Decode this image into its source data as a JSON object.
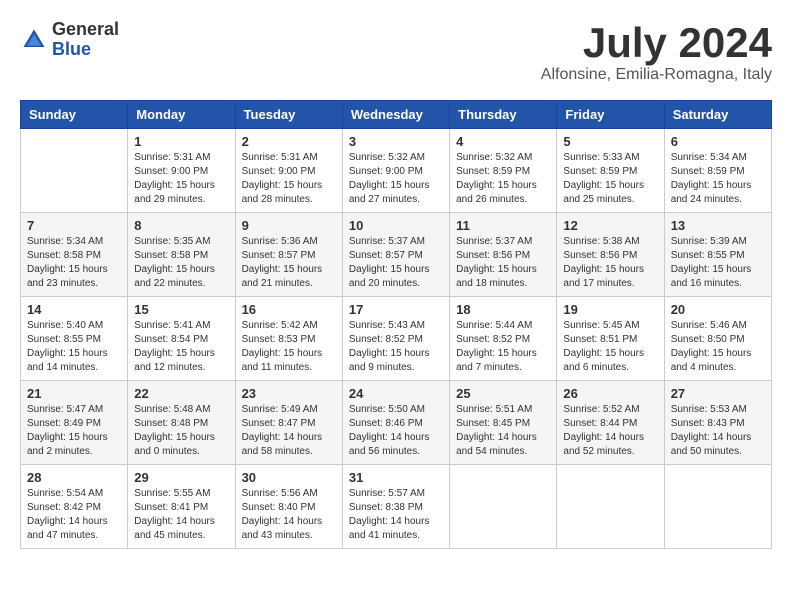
{
  "logo": {
    "general": "General",
    "blue": "Blue"
  },
  "title": {
    "month_year": "July 2024",
    "location": "Alfonsine, Emilia-Romagna, Italy"
  },
  "headers": [
    "Sunday",
    "Monday",
    "Tuesday",
    "Wednesday",
    "Thursday",
    "Friday",
    "Saturday"
  ],
  "weeks": [
    [
      {
        "day": "",
        "sunrise": "",
        "sunset": "",
        "daylight": ""
      },
      {
        "day": "1",
        "sunrise": "Sunrise: 5:31 AM",
        "sunset": "Sunset: 9:00 PM",
        "daylight": "Daylight: 15 hours and 29 minutes."
      },
      {
        "day": "2",
        "sunrise": "Sunrise: 5:31 AM",
        "sunset": "Sunset: 9:00 PM",
        "daylight": "Daylight: 15 hours and 28 minutes."
      },
      {
        "day": "3",
        "sunrise": "Sunrise: 5:32 AM",
        "sunset": "Sunset: 9:00 PM",
        "daylight": "Daylight: 15 hours and 27 minutes."
      },
      {
        "day": "4",
        "sunrise": "Sunrise: 5:32 AM",
        "sunset": "Sunset: 8:59 PM",
        "daylight": "Daylight: 15 hours and 26 minutes."
      },
      {
        "day": "5",
        "sunrise": "Sunrise: 5:33 AM",
        "sunset": "Sunset: 8:59 PM",
        "daylight": "Daylight: 15 hours and 25 minutes."
      },
      {
        "day": "6",
        "sunrise": "Sunrise: 5:34 AM",
        "sunset": "Sunset: 8:59 PM",
        "daylight": "Daylight: 15 hours and 24 minutes."
      }
    ],
    [
      {
        "day": "7",
        "sunrise": "Sunrise: 5:34 AM",
        "sunset": "Sunset: 8:58 PM",
        "daylight": "Daylight: 15 hours and 23 minutes."
      },
      {
        "day": "8",
        "sunrise": "Sunrise: 5:35 AM",
        "sunset": "Sunset: 8:58 PM",
        "daylight": "Daylight: 15 hours and 22 minutes."
      },
      {
        "day": "9",
        "sunrise": "Sunrise: 5:36 AM",
        "sunset": "Sunset: 8:57 PM",
        "daylight": "Daylight: 15 hours and 21 minutes."
      },
      {
        "day": "10",
        "sunrise": "Sunrise: 5:37 AM",
        "sunset": "Sunset: 8:57 PM",
        "daylight": "Daylight: 15 hours and 20 minutes."
      },
      {
        "day": "11",
        "sunrise": "Sunrise: 5:37 AM",
        "sunset": "Sunset: 8:56 PM",
        "daylight": "Daylight: 15 hours and 18 minutes."
      },
      {
        "day": "12",
        "sunrise": "Sunrise: 5:38 AM",
        "sunset": "Sunset: 8:56 PM",
        "daylight": "Daylight: 15 hours and 17 minutes."
      },
      {
        "day": "13",
        "sunrise": "Sunrise: 5:39 AM",
        "sunset": "Sunset: 8:55 PM",
        "daylight": "Daylight: 15 hours and 16 minutes."
      }
    ],
    [
      {
        "day": "14",
        "sunrise": "Sunrise: 5:40 AM",
        "sunset": "Sunset: 8:55 PM",
        "daylight": "Daylight: 15 hours and 14 minutes."
      },
      {
        "day": "15",
        "sunrise": "Sunrise: 5:41 AM",
        "sunset": "Sunset: 8:54 PM",
        "daylight": "Daylight: 15 hours and 12 minutes."
      },
      {
        "day": "16",
        "sunrise": "Sunrise: 5:42 AM",
        "sunset": "Sunset: 8:53 PM",
        "daylight": "Daylight: 15 hours and 11 minutes."
      },
      {
        "day": "17",
        "sunrise": "Sunrise: 5:43 AM",
        "sunset": "Sunset: 8:52 PM",
        "daylight": "Daylight: 15 hours and 9 minutes."
      },
      {
        "day": "18",
        "sunrise": "Sunrise: 5:44 AM",
        "sunset": "Sunset: 8:52 PM",
        "daylight": "Daylight: 15 hours and 7 minutes."
      },
      {
        "day": "19",
        "sunrise": "Sunrise: 5:45 AM",
        "sunset": "Sunset: 8:51 PM",
        "daylight": "Daylight: 15 hours and 6 minutes."
      },
      {
        "day": "20",
        "sunrise": "Sunrise: 5:46 AM",
        "sunset": "Sunset: 8:50 PM",
        "daylight": "Daylight: 15 hours and 4 minutes."
      }
    ],
    [
      {
        "day": "21",
        "sunrise": "Sunrise: 5:47 AM",
        "sunset": "Sunset: 8:49 PM",
        "daylight": "Daylight: 15 hours and 2 minutes."
      },
      {
        "day": "22",
        "sunrise": "Sunrise: 5:48 AM",
        "sunset": "Sunset: 8:48 PM",
        "daylight": "Daylight: 15 hours and 0 minutes."
      },
      {
        "day": "23",
        "sunrise": "Sunrise: 5:49 AM",
        "sunset": "Sunset: 8:47 PM",
        "daylight": "Daylight: 14 hours and 58 minutes."
      },
      {
        "day": "24",
        "sunrise": "Sunrise: 5:50 AM",
        "sunset": "Sunset: 8:46 PM",
        "daylight": "Daylight: 14 hours and 56 minutes."
      },
      {
        "day": "25",
        "sunrise": "Sunrise: 5:51 AM",
        "sunset": "Sunset: 8:45 PM",
        "daylight": "Daylight: 14 hours and 54 minutes."
      },
      {
        "day": "26",
        "sunrise": "Sunrise: 5:52 AM",
        "sunset": "Sunset: 8:44 PM",
        "daylight": "Daylight: 14 hours and 52 minutes."
      },
      {
        "day": "27",
        "sunrise": "Sunrise: 5:53 AM",
        "sunset": "Sunset: 8:43 PM",
        "daylight": "Daylight: 14 hours and 50 minutes."
      }
    ],
    [
      {
        "day": "28",
        "sunrise": "Sunrise: 5:54 AM",
        "sunset": "Sunset: 8:42 PM",
        "daylight": "Daylight: 14 hours and 47 minutes."
      },
      {
        "day": "29",
        "sunrise": "Sunrise: 5:55 AM",
        "sunset": "Sunset: 8:41 PM",
        "daylight": "Daylight: 14 hours and 45 minutes."
      },
      {
        "day": "30",
        "sunrise": "Sunrise: 5:56 AM",
        "sunset": "Sunset: 8:40 PM",
        "daylight": "Daylight: 14 hours and 43 minutes."
      },
      {
        "day": "31",
        "sunrise": "Sunrise: 5:57 AM",
        "sunset": "Sunset: 8:38 PM",
        "daylight": "Daylight: 14 hours and 41 minutes."
      },
      {
        "day": "",
        "sunrise": "",
        "sunset": "",
        "daylight": ""
      },
      {
        "day": "",
        "sunrise": "",
        "sunset": "",
        "daylight": ""
      },
      {
        "day": "",
        "sunrise": "",
        "sunset": "",
        "daylight": ""
      }
    ]
  ]
}
